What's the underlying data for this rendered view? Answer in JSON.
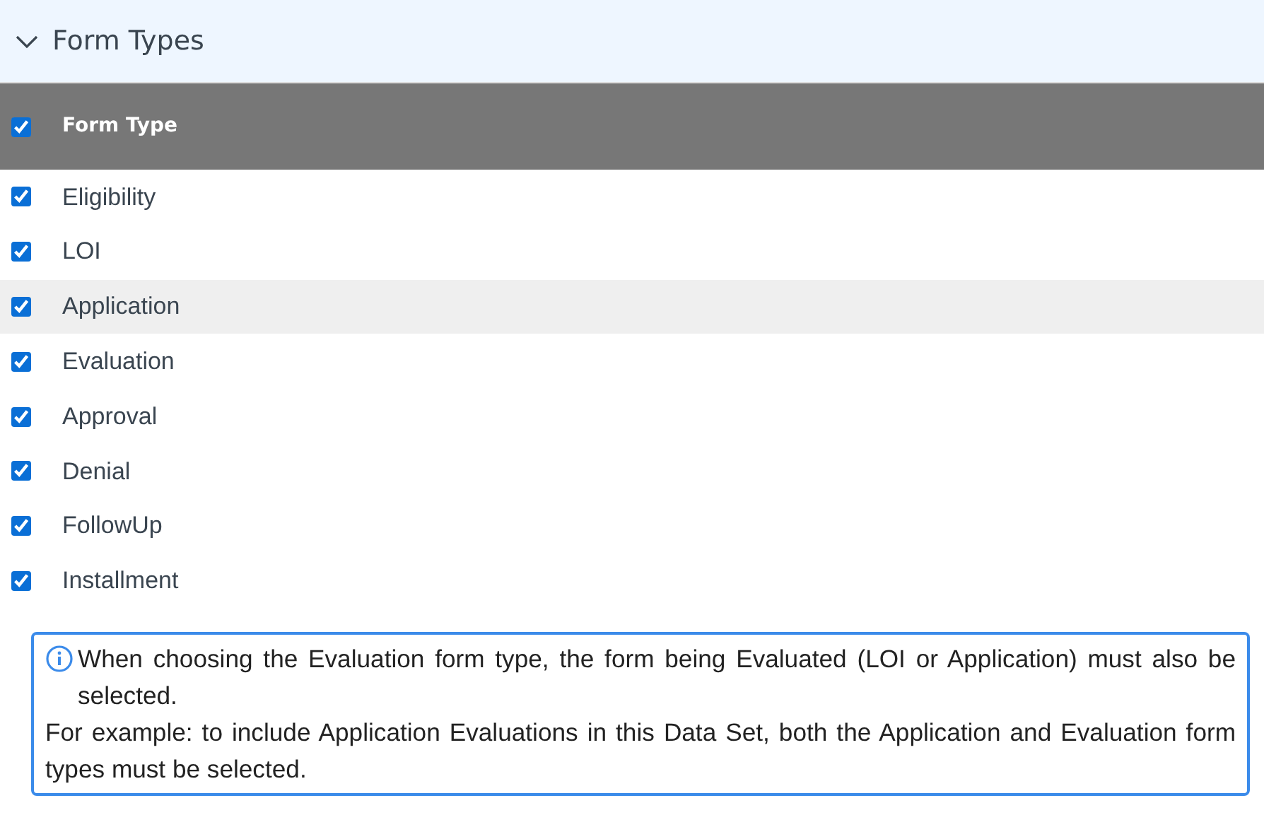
{
  "section": {
    "title": "Form Types",
    "expanded": true
  },
  "table": {
    "header": {
      "label": "Form Type",
      "checked": true
    },
    "rows": [
      {
        "label": "Eligibility",
        "checked": true,
        "highlighted": false
      },
      {
        "label": "LOI",
        "checked": true,
        "highlighted": false
      },
      {
        "label": "Application",
        "checked": true,
        "highlighted": true
      },
      {
        "label": "Evaluation",
        "checked": true,
        "highlighted": false
      },
      {
        "label": "Approval",
        "checked": true,
        "highlighted": false
      },
      {
        "label": "Denial",
        "checked": true,
        "highlighted": false
      },
      {
        "label": "FollowUp",
        "checked": true,
        "highlighted": false
      },
      {
        "label": "Installment",
        "checked": true,
        "highlighted": false
      }
    ]
  },
  "info": {
    "paragraphs": [
      "When choosing the Evaluation form type, the form being Evaluated (LOI or Application) must also be selected.",
      "For example: to include Application Evaluations in this Data Set, both the Application and Evaluation form types must be selected."
    ]
  }
}
